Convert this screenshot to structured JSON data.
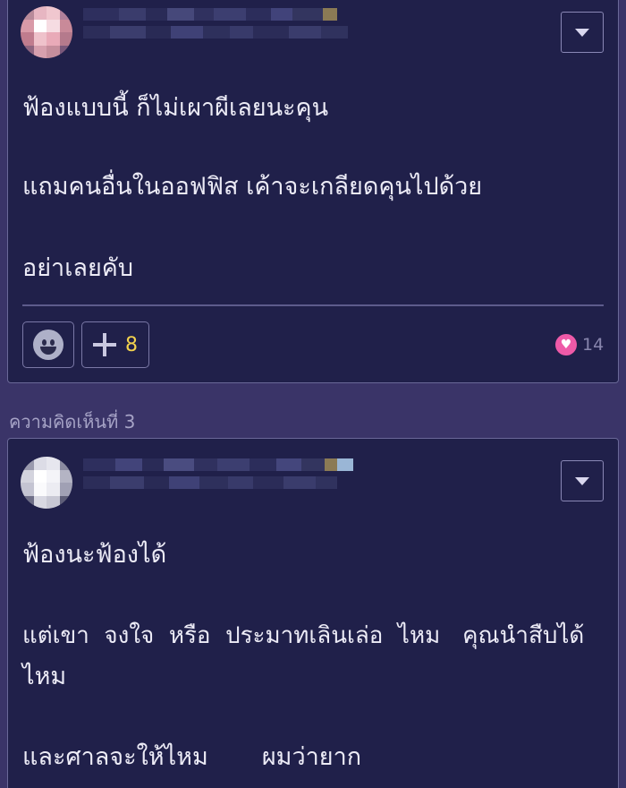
{
  "comments": [
    {
      "lines": [
        "ฟ้องแบบนี้ ก็ไม่เผาผีเลยนะคุน",
        "แถมคนอื่นในออฟฟิส เค้าจะเกลียดคุนไปด้วย",
        "อย่าเลยคับ"
      ],
      "plus_count": "8",
      "like_count": "14"
    },
    {
      "label": "ความคิดเห็นที่ 3",
      "lines": [
        "ฟ้องนะฟ้องได้",
        "แต่เขา  จงใจ  หรือ  ประมาทเลินเล่อ  ไหม   คุณนำสืบได้",
        "ไหม",
        "และศาลจะให้ไหม       ผมว่ายาก"
      ]
    }
  ],
  "icons": {
    "dropdown": "chevron-down-icon",
    "emoji": "smiley-icon",
    "plus": "plus-icon",
    "heart": "heart-icon"
  },
  "colors": {
    "page_bg": "#3a3468",
    "card_bg": "#20204a",
    "card_border": "#6a6898",
    "plus_count": "#f3d24e",
    "heart": "#ee5aa8"
  }
}
